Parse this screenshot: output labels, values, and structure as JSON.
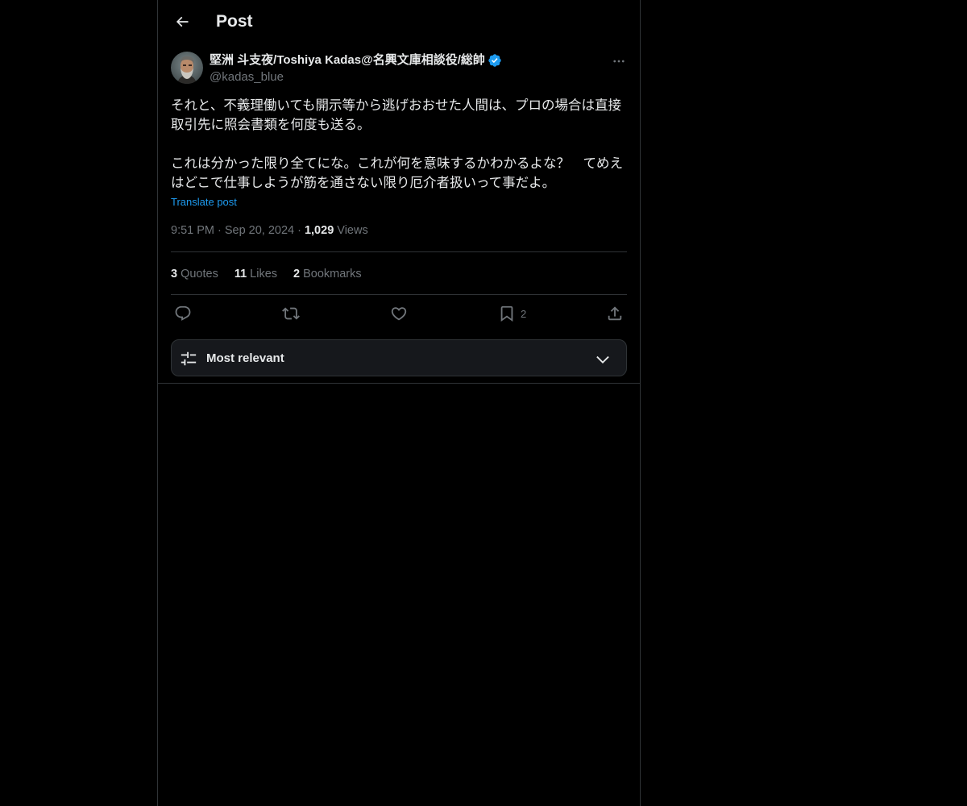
{
  "header": {
    "title": "Post",
    "back_icon": "arrow-left-icon"
  },
  "post": {
    "author": {
      "display_name": "堅洲 斗支夜/Toshiya Kadas@名興文庫相談役/総帥",
      "handle": "@kadas_blue",
      "verified": true,
      "verified_color": "#1d9bf0"
    },
    "text": "それと、不義理働いても開示等から逃げおおせた人間は、プロの場合は直接取引先に照会書類を何度も送る。\n\nこれは分かった限り全てにな。これが何を意味するかわかるよな？　てめえはどこで仕事しようが筋を通さない限り厄介者扱いって事だよ。",
    "translate_label": "Translate post",
    "time": "9:51 PM",
    "date": "Sep 20, 2024",
    "views_count": "1,029",
    "views_label": "Views",
    "stats": {
      "quotes_count": "3",
      "quotes_label": "Quotes",
      "likes_count": "11",
      "likes_label": "Likes",
      "bookmarks_count": "2",
      "bookmarks_label": "Bookmarks"
    },
    "actions": {
      "reply_icon": "reply-icon",
      "repost_icon": "repost-icon",
      "like_icon": "heart-icon",
      "bookmark_icon": "bookmark-icon",
      "bookmark_count": "2",
      "share_icon": "share-icon"
    }
  },
  "replies_sort": {
    "label": "Most relevant",
    "icon": "sliders-icon",
    "chevron": "chevron-down-icon"
  },
  "colors": {
    "background": "#000000",
    "text_primary": "#e7e9ea",
    "text_secondary": "#71767b",
    "accent": "#1d9bf0",
    "border": "#2f3336"
  }
}
